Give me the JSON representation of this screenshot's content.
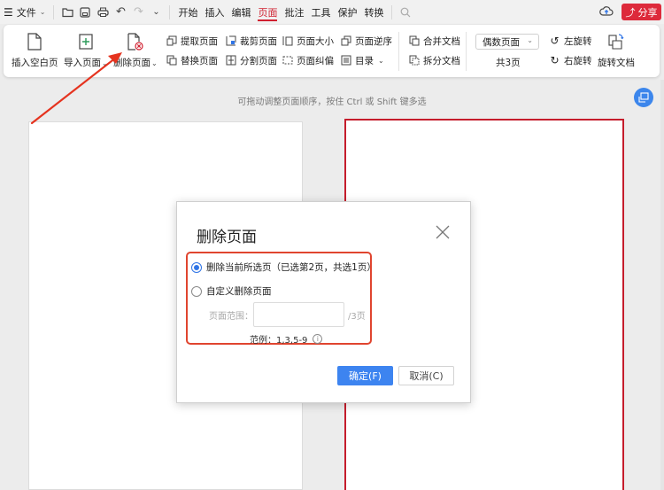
{
  "menubar": {
    "menu_label": "文件",
    "tabs": [
      {
        "label": "开始",
        "active": false
      },
      {
        "label": "插入",
        "active": false
      },
      {
        "label": "编辑",
        "active": false
      },
      {
        "label": "页面",
        "active": true
      },
      {
        "label": "批注",
        "active": false
      },
      {
        "label": "工具",
        "active": false
      },
      {
        "label": "保护",
        "active": false
      },
      {
        "label": "转换",
        "active": false
      }
    ],
    "share_label": "分享",
    "accent_color": "#d01f2f"
  },
  "ribbon": {
    "insert_blank": "插入空白页",
    "import_page": "导入页面",
    "delete_page": "删除页面",
    "extract_page": "提取页面",
    "replace_page": "替换页面",
    "crop_page": "裁剪页面",
    "split_page": "分割页面",
    "page_size": "页面大小",
    "page_deskew": "页面纠偏",
    "reverse_order": "页面逆序",
    "toc": "目录",
    "merge_docs": "合并文档",
    "split_docs": "拆分文档",
    "page_filter": "偶数页面",
    "page_count": "共3页",
    "rotate_left": "左旋转",
    "rotate_right": "右旋转",
    "rotate_doc": "旋转文档"
  },
  "canvas": {
    "hint": "可拖动调整页面顺序，按住 Ctrl 或 Shift 键多选",
    "selected_page": 2
  },
  "dialog": {
    "title": "删除页面",
    "option_current": "删除当前所选页（已选第2页，共选1页）",
    "option_custom": "自定义删除页面",
    "selected_option": "current",
    "range_label": "页面范围：",
    "range_value": "",
    "range_suffix": "/3页",
    "example": "范例：1,3,5-9",
    "ok_label": "确定(F)",
    "cancel_label": "取消(C)",
    "primary_color": "#3d84f0",
    "highlight_color": "#e0452f"
  }
}
